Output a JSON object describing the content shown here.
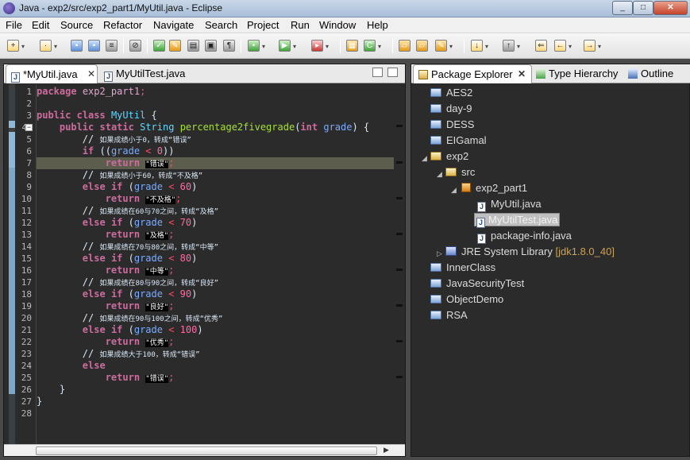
{
  "window": {
    "title": "Java - exp2/src/exp2_part1/MyUtil.java - Eclipse"
  },
  "menu": [
    "File",
    "Edit",
    "Source",
    "Refactor",
    "Navigate",
    "Search",
    "Project",
    "Run",
    "Window",
    "Help"
  ],
  "editor": {
    "tabs": [
      {
        "label": "*MyUtil.java",
        "active": true
      },
      {
        "label": "MyUtilTest.java",
        "active": false
      }
    ],
    "line_numbers": [
      "1",
      "2",
      "3",
      "4",
      "5",
      "6",
      "7",
      "8",
      "9",
      "10",
      "11",
      "12",
      "13",
      "14",
      "15",
      "16",
      "17",
      "18",
      "19",
      "20",
      "21",
      "22",
      "23",
      "24",
      "25",
      "26",
      "27",
      "28"
    ],
    "code": {
      "l1_kw": "package",
      "l1_pkg": "exp2_part1",
      "l1_sc": ";",
      "l3_kw1": "public",
      "l3_kw2": "class",
      "l3_name": "MyUtil",
      "l3_brace": "{",
      "l4_kw1": "public",
      "l4_kw2": "static",
      "l4_type": "String",
      "l4_fn": "percentage2fivegrade",
      "l4_p1": "(",
      "l4_kw3": "int",
      "l4_var": "grade",
      "l4_p2": ") {",
      "l5_cm": "// ",
      "l5_cn": "如果成绩小于0，转成“错误”",
      "l6_kw": "if",
      "l6_p1": " ((",
      "l6_var": "grade",
      "l6_op": " < ",
      "l6_num": "0",
      "l6_p2": "))",
      "l7_kw": "return",
      "l7_str": "\"错误\"",
      "l7_sc": ";",
      "l8_cm": "// ",
      "l8_cn": "如果成绩小于60，转成“不及格”",
      "l9_kw1": "else",
      "l9_kw2": "if",
      "l9_p1": " (",
      "l9_var": "grade",
      "l9_op": " < ",
      "l9_num": "60",
      "l9_p2": ")",
      "l10_kw": "return",
      "l10_str": "\"不及格\"",
      "l10_sc": ";",
      "l11_cm": "// ",
      "l11_cn": "如果成绩在60与70之间，转成“及格”",
      "l12_kw1": "else",
      "l12_kw2": "if",
      "l12_p1": " (",
      "l12_var": "grade",
      "l12_op": " < ",
      "l12_num": "70",
      "l12_p2": ")",
      "l13_kw": "return",
      "l13_str": "\"及格\"",
      "l13_sc": ";",
      "l14_cm": "// ",
      "l14_cn": "如果成绩在70与80之间，转成“中等”",
      "l15_kw1": "else",
      "l15_kw2": "if",
      "l15_p1": " (",
      "l15_var": "grade",
      "l15_op": " < ",
      "l15_num": "80",
      "l15_p2": ")",
      "l16_kw": "return",
      "l16_str": "\"中等\"",
      "l16_sc": ";",
      "l17_cm": "// ",
      "l17_cn": "如果成绩在80与90之间，转成“良好”",
      "l18_kw1": "else",
      "l18_kw2": "if",
      "l18_p1": " (",
      "l18_var": "grade",
      "l18_op": " < ",
      "l18_num": "90",
      "l18_p2": ")",
      "l19_kw": "return",
      "l19_str": "\"良好\"",
      "l19_sc": ";",
      "l20_cm": "// ",
      "l20_cn": "如果成绩在90与100之间，转成“优秀”",
      "l21_kw1": "else",
      "l21_kw2": "if",
      "l21_p1": " (",
      "l21_var": "grade",
      "l21_op": " < ",
      "l21_num": "100",
      "l21_p2": ")",
      "l22_kw": "return",
      "l22_str": "\"优秀\"",
      "l22_sc": ";",
      "l23_cm": "// ",
      "l23_cn": "如果成绩大于100，转成“错误”",
      "l24_kw": "else",
      "l25_kw": "return",
      "l25_str": "\"错误\"",
      "l25_sc": ";",
      "l26": "}",
      "l27": "}"
    }
  },
  "explorer": {
    "tabs": [
      {
        "label": "Package Explorer",
        "active": true
      },
      {
        "label": "Type Hierarchy",
        "active": false
      },
      {
        "label": "Outline",
        "active": false
      }
    ],
    "tree": {
      "aes2": "AES2",
      "day9": "day-9",
      "dess": "DESS",
      "eigamal": "EIGamal",
      "exp2": "exp2",
      "src": "src",
      "pkg": "exp2_part1",
      "file1": "MyUtil.java",
      "file2": "MyUtilTest.java",
      "file3": "package-info.java",
      "jre": "JRE System Library",
      "jre_ver": "[jdk1.8.0_40]",
      "innerclass": "InnerClass",
      "javasec": "JavaSecurityTest",
      "objdemo": "ObjectDemo",
      "rsa": "RSA"
    }
  }
}
